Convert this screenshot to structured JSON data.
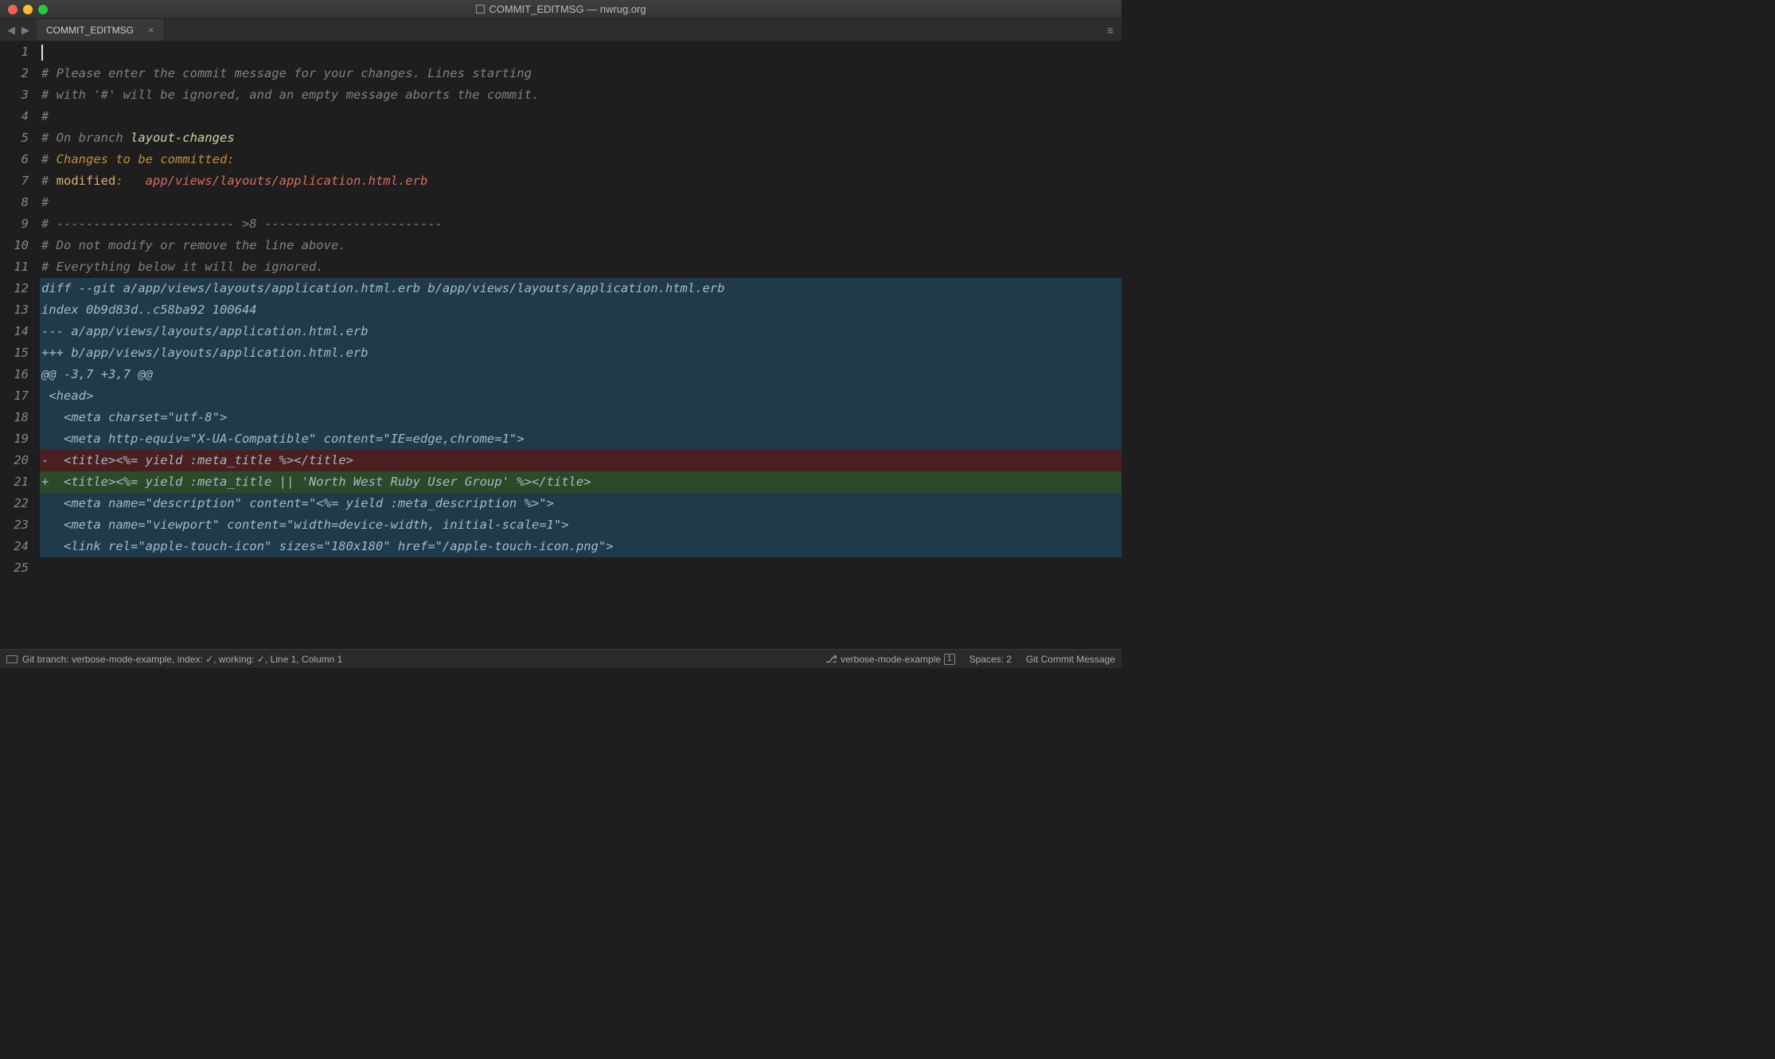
{
  "window": {
    "title": "COMMIT_EDITMSG — nwrug.org"
  },
  "tab": {
    "label": "COMMIT_EDITMSG",
    "close": "×"
  },
  "nav": {
    "back": "◀",
    "forward": "▶"
  },
  "burger": "≡",
  "lines": [
    {
      "n": "1",
      "type": "cursor",
      "text": ""
    },
    {
      "n": "2",
      "type": "comment",
      "text": "# Please enter the commit message for your changes. Lines starting"
    },
    {
      "n": "3",
      "type": "comment",
      "text": "# with '#' will be ignored, and an empty message aborts the commit."
    },
    {
      "n": "4",
      "type": "comment",
      "text": "#"
    },
    {
      "n": "5",
      "type": "branch",
      "prefix": "# On branch ",
      "branch": "layout-changes"
    },
    {
      "n": "6",
      "type": "changes",
      "prefix": "# ",
      "text": "Changes to be committed:"
    },
    {
      "n": "7",
      "type": "modified",
      "prefix": "# ",
      "label": "modified",
      "colon": ":",
      "spacer": "   ",
      "path": "app/views/layouts/application.html.erb"
    },
    {
      "n": "8",
      "type": "comment",
      "text": "#"
    },
    {
      "n": "9",
      "type": "comment",
      "text": "# ------------------------ >8 ------------------------"
    },
    {
      "n": "10",
      "type": "comment",
      "text": "# Do not modify or remove the line above."
    },
    {
      "n": "11",
      "type": "comment",
      "text": "# Everything below it will be ignored."
    },
    {
      "n": "12",
      "type": "diffhead",
      "text": "diff --git a/app/views/layouts/application.html.erb b/app/views/layouts/application.html.erb"
    },
    {
      "n": "13",
      "type": "diffhead",
      "text": "index 0b9d83d..c58ba92 100644"
    },
    {
      "n": "14",
      "type": "diffhead",
      "text": "--- a/app/views/layouts/application.html.erb"
    },
    {
      "n": "15",
      "type": "diffhead",
      "text": "+++ b/app/views/layouts/application.html.erb"
    },
    {
      "n": "16",
      "type": "diffhead",
      "text": "@@ -3,7 +3,7 @@"
    },
    {
      "n": "17",
      "type": "diffctx",
      "text": " <head>"
    },
    {
      "n": "18",
      "type": "diffctx",
      "text": "   <meta charset=\"utf-8\">"
    },
    {
      "n": "19",
      "type": "diffctx",
      "text": "   <meta http-equiv=\"X-UA-Compatible\" content=\"IE=edge,chrome=1\">"
    },
    {
      "n": "20",
      "type": "diffdel",
      "text": "-  <title><%= yield :meta_title %></title>"
    },
    {
      "n": "21",
      "type": "diffadd",
      "text": "+  <title><%= yield :meta_title || 'North West Ruby User Group' %></title>"
    },
    {
      "n": "22",
      "type": "diffctx",
      "text": "   <meta name=\"description\" content=\"<%= yield :meta_description %>\">"
    },
    {
      "n": "23",
      "type": "diffctx",
      "text": "   <meta name=\"viewport\" content=\"width=device-width, initial-scale=1\">"
    },
    {
      "n": "24",
      "type": "diffctx",
      "text": "   <link rel=\"apple-touch-icon\" sizes=\"180x180\" href=\"/apple-touch-icon.png\">"
    },
    {
      "n": "25",
      "type": "empty",
      "text": ""
    }
  ],
  "status": {
    "left": "Git branch: verbose-mode-example, index: ✓, working: ✓, Line 1, Column 1",
    "branch_icon": "⎇",
    "branch": "verbose-mode-example",
    "branch_count": "1",
    "spaces": "Spaces: 2",
    "mode": "Git Commit Message"
  }
}
